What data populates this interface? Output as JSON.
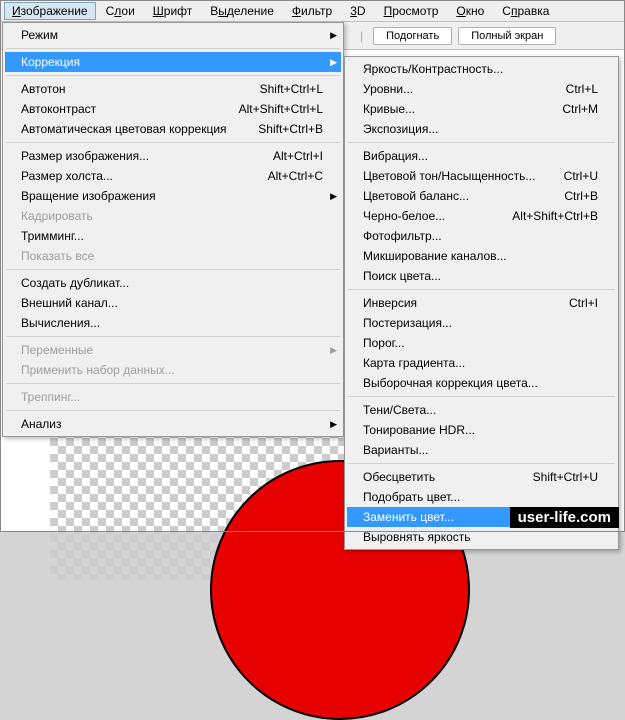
{
  "menubar": {
    "items": [
      {
        "label": "Изображение",
        "u": 0
      },
      {
        "label": "Слои",
        "u": 1
      },
      {
        "label": "Шрифт",
        "u": 0
      },
      {
        "label": "Выделение",
        "u": 1
      },
      {
        "label": "Фильтр",
        "u": 0
      },
      {
        "label": "3D",
        "u": 0
      },
      {
        "label": "Просмотр",
        "u": 0
      },
      {
        "label": "Окно",
        "u": 0
      },
      {
        "label": "Справка",
        "u": 1
      }
    ]
  },
  "toolbar": {
    "fit": "Подогнать",
    "fullscreen": "Полный экран"
  },
  "mainMenu": [
    {
      "type": "item",
      "label": "Режим",
      "submenu": true
    },
    {
      "type": "sep"
    },
    {
      "type": "item",
      "label": "Коррекция",
      "submenu": true,
      "highlighted": true
    },
    {
      "type": "sep"
    },
    {
      "type": "item",
      "label": "Автотон",
      "shortcut": "Shift+Ctrl+L"
    },
    {
      "type": "item",
      "label": "Автоконтраст",
      "shortcut": "Alt+Shift+Ctrl+L"
    },
    {
      "type": "item",
      "label": "Автоматическая цветовая коррекция",
      "shortcut": "Shift+Ctrl+B"
    },
    {
      "type": "sep"
    },
    {
      "type": "item",
      "label": "Размер изображения...",
      "shortcut": "Alt+Ctrl+I"
    },
    {
      "type": "item",
      "label": "Размер холста...",
      "shortcut": "Alt+Ctrl+C"
    },
    {
      "type": "item",
      "label": "Вращение изображения",
      "submenu": true
    },
    {
      "type": "item",
      "label": "Кадрировать",
      "disabled": true
    },
    {
      "type": "item",
      "label": "Тримминг..."
    },
    {
      "type": "item",
      "label": "Показать все",
      "disabled": true
    },
    {
      "type": "sep"
    },
    {
      "type": "item",
      "label": "Создать дубликат..."
    },
    {
      "type": "item",
      "label": "Внешний канал..."
    },
    {
      "type": "item",
      "label": "Вычисления..."
    },
    {
      "type": "sep"
    },
    {
      "type": "item",
      "label": "Переменные",
      "submenu": true,
      "disabled": true
    },
    {
      "type": "item",
      "label": "Применить набор данных...",
      "disabled": true
    },
    {
      "type": "sep"
    },
    {
      "type": "item",
      "label": "Треппинг...",
      "disabled": true
    },
    {
      "type": "sep"
    },
    {
      "type": "item",
      "label": "Анализ",
      "submenu": true
    }
  ],
  "subMenu": [
    {
      "type": "item",
      "label": "Яркость/Контрастность..."
    },
    {
      "type": "item",
      "label": "Уровни...",
      "shortcut": "Ctrl+L"
    },
    {
      "type": "item",
      "label": "Кривые...",
      "shortcut": "Ctrl+M"
    },
    {
      "type": "item",
      "label": "Экспозиция..."
    },
    {
      "type": "sep"
    },
    {
      "type": "item",
      "label": "Вибрация..."
    },
    {
      "type": "item",
      "label": "Цветовой тон/Насыщенность...",
      "shortcut": "Ctrl+U"
    },
    {
      "type": "item",
      "label": "Цветовой баланс...",
      "shortcut": "Ctrl+B"
    },
    {
      "type": "item",
      "label": "Черно-белое...",
      "shortcut": "Alt+Shift+Ctrl+B"
    },
    {
      "type": "item",
      "label": "Фотофильтр..."
    },
    {
      "type": "item",
      "label": "Микширование каналов..."
    },
    {
      "type": "item",
      "label": "Поиск цвета..."
    },
    {
      "type": "sep"
    },
    {
      "type": "item",
      "label": "Инверсия",
      "shortcut": "Ctrl+I"
    },
    {
      "type": "item",
      "label": "Постеризация..."
    },
    {
      "type": "item",
      "label": "Порог..."
    },
    {
      "type": "item",
      "label": "Карта градиента..."
    },
    {
      "type": "item",
      "label": "Выборочная коррекция цвета..."
    },
    {
      "type": "sep"
    },
    {
      "type": "item",
      "label": "Тени/Света..."
    },
    {
      "type": "item",
      "label": "Тонирование HDR..."
    },
    {
      "type": "item",
      "label": "Варианты..."
    },
    {
      "type": "sep"
    },
    {
      "type": "item",
      "label": "Обесцветить",
      "shortcut": "Shift+Ctrl+U"
    },
    {
      "type": "item",
      "label": "Подобрать цвет..."
    },
    {
      "type": "item",
      "label": "Заменить цвет...",
      "highlighted": true
    },
    {
      "type": "item",
      "label": "Выровнять яркость"
    }
  ],
  "watermark": "user-life.com"
}
